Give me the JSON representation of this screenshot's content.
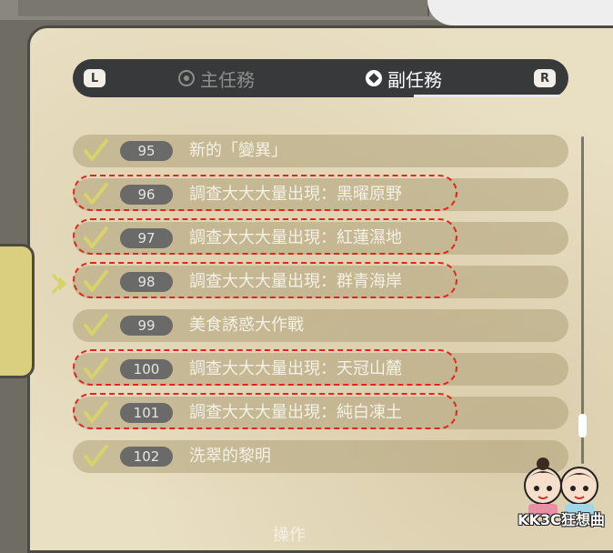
{
  "tabbar": {
    "left_key": "L",
    "right_key": "R",
    "tabs": [
      {
        "label": "主任務",
        "active": false
      },
      {
        "label": "副任務",
        "active": true
      }
    ]
  },
  "quests": [
    {
      "number": "95",
      "title": "新的「變異」",
      "highlighted": false
    },
    {
      "number": "96",
      "title": "調查大大大量出現：黑曜原野",
      "highlighted": true
    },
    {
      "number": "97",
      "title": "調查大大大量出現：紅蓮濕地",
      "highlighted": true
    },
    {
      "number": "98",
      "title": "調查大大大量出現：群青海岸",
      "highlighted": true
    },
    {
      "number": "99",
      "title": "美食誘惑大作戰",
      "highlighted": false
    },
    {
      "number": "100",
      "title": "調查大大大量出現：天冠山麓",
      "highlighted": true
    },
    {
      "number": "101",
      "title": "調查大大大量出現：純白凍土",
      "highlighted": true
    },
    {
      "number": "102",
      "title": "洗翠的黎明",
      "highlighted": false
    }
  ],
  "selected_quest": "98",
  "bottom_partial_text": "操作",
  "watermark": "KK3C狂想曲",
  "colors": {
    "highlight_dash": "#e2261f",
    "check": "#d8d26a",
    "tabbar": "#38393b"
  }
}
